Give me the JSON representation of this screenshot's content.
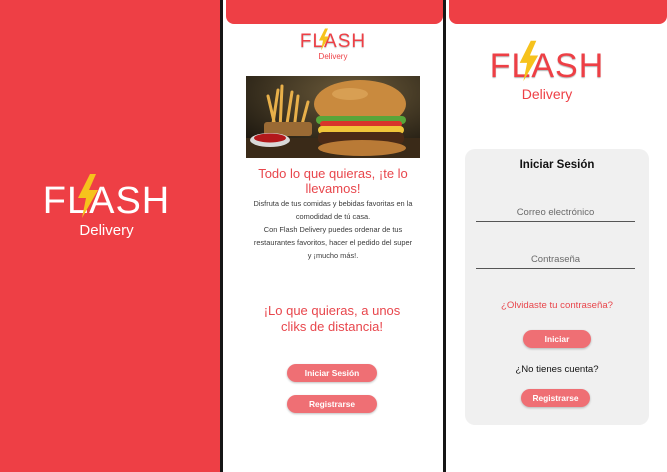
{
  "brand": {
    "name": "FLASH",
    "sub": "Delivery",
    "colors": {
      "primary": "#ee3f45",
      "button": "#ef6f74",
      "bolt": "#f6c21c"
    }
  },
  "welcome": {
    "image_icon": "burger-fries-photo",
    "headline": "Todo lo que quieras, ¡te lo llevamos!",
    "body_1": "Disfruta de tus comidas y bebidas favoritas en la comodidad de tú casa.",
    "body_2": "Con Flash Delivery puedes ordenar de tus restaurantes favoritos, hacer el pedido del super y ¡mucho más!.",
    "tagline": "¡Lo que quieras, a unos cliks de distancia!",
    "login_button": "Iniciar Sesión",
    "register_button": "Registrarse"
  },
  "login": {
    "title": "Iniciar Sesión",
    "email_placeholder": "Correo electrónico",
    "password_placeholder": "Contraseña",
    "forgot_link": "¿Olvidaste tu contraseña?",
    "submit_button": "Iniciar",
    "no_account": "¿No tienes cuenta?",
    "register_button": "Registrarse"
  }
}
